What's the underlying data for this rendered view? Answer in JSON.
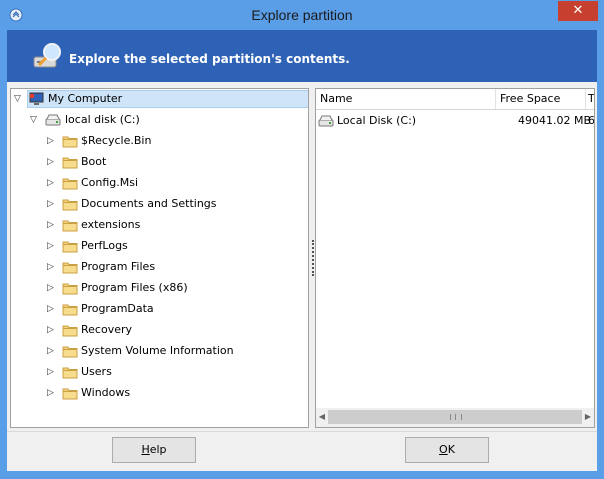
{
  "window": {
    "title": "Explore partition",
    "close_glyph": "✕"
  },
  "banner": {
    "text": "Explore the selected partition's contents."
  },
  "tree": {
    "root": "My Computer",
    "drive": "local disk (C:)",
    "folders": [
      "$Recycle.Bin",
      "Boot",
      "Config.Msi",
      "Documents and Settings",
      "extensions",
      "PerfLogs",
      "Program Files",
      "Program Files (x86)",
      "ProgramData",
      "Recovery",
      "System Volume Information",
      "Users",
      "Windows"
    ]
  },
  "list": {
    "columns": [
      "Name",
      "Free Space",
      "T"
    ],
    "rows": [
      {
        "name": "Local Disk (C:)",
        "free_space": "49041.02 MB",
        "t": "6"
      }
    ]
  },
  "buttons": {
    "help_prefix": "",
    "help_mnemonic": "H",
    "help_suffix": "elp",
    "ok_prefix": "",
    "ok_mnemonic": "O",
    "ok_suffix": "K"
  },
  "colors": {
    "titlebar": "#5b9ee8",
    "banner": "#2e62b6",
    "close": "#c7402f",
    "selection": "#cfe4f8"
  }
}
